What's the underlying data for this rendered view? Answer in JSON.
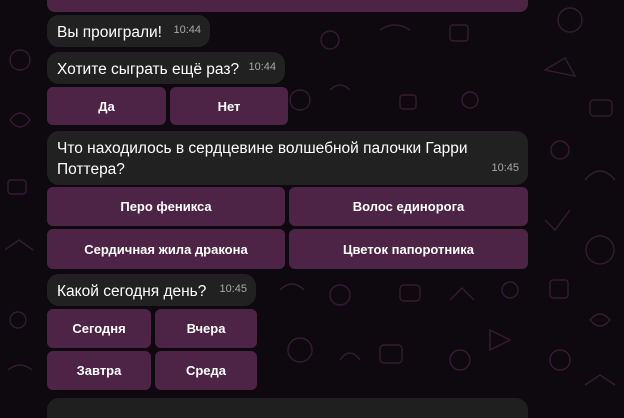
{
  "messages": [
    {
      "text": "Вы проиграли!",
      "time": "10:44"
    },
    {
      "text": "Хотите сыграть ещё раз?",
      "time": "10:44"
    },
    {
      "text": "Что находилось в сердцевине волшебной палочки Гарри Поттера?",
      "time": "10:45"
    },
    {
      "text": "Какой сегодня день?",
      "time": "10:45"
    }
  ],
  "keyboards": {
    "play_again": [
      "Да",
      "Нет"
    ],
    "wand_core": [
      "Перо феникса",
      "Волос единорога",
      "Сердичная жила дракона",
      "Цветок папоротника"
    ],
    "day": [
      "Сегодня",
      "Вчера",
      "Завтра",
      "Среда"
    ]
  },
  "colors": {
    "background": "#0d090f",
    "bubble": "#212121",
    "inline_button": "#4d2446",
    "time_text": "#a8a8a8"
  }
}
